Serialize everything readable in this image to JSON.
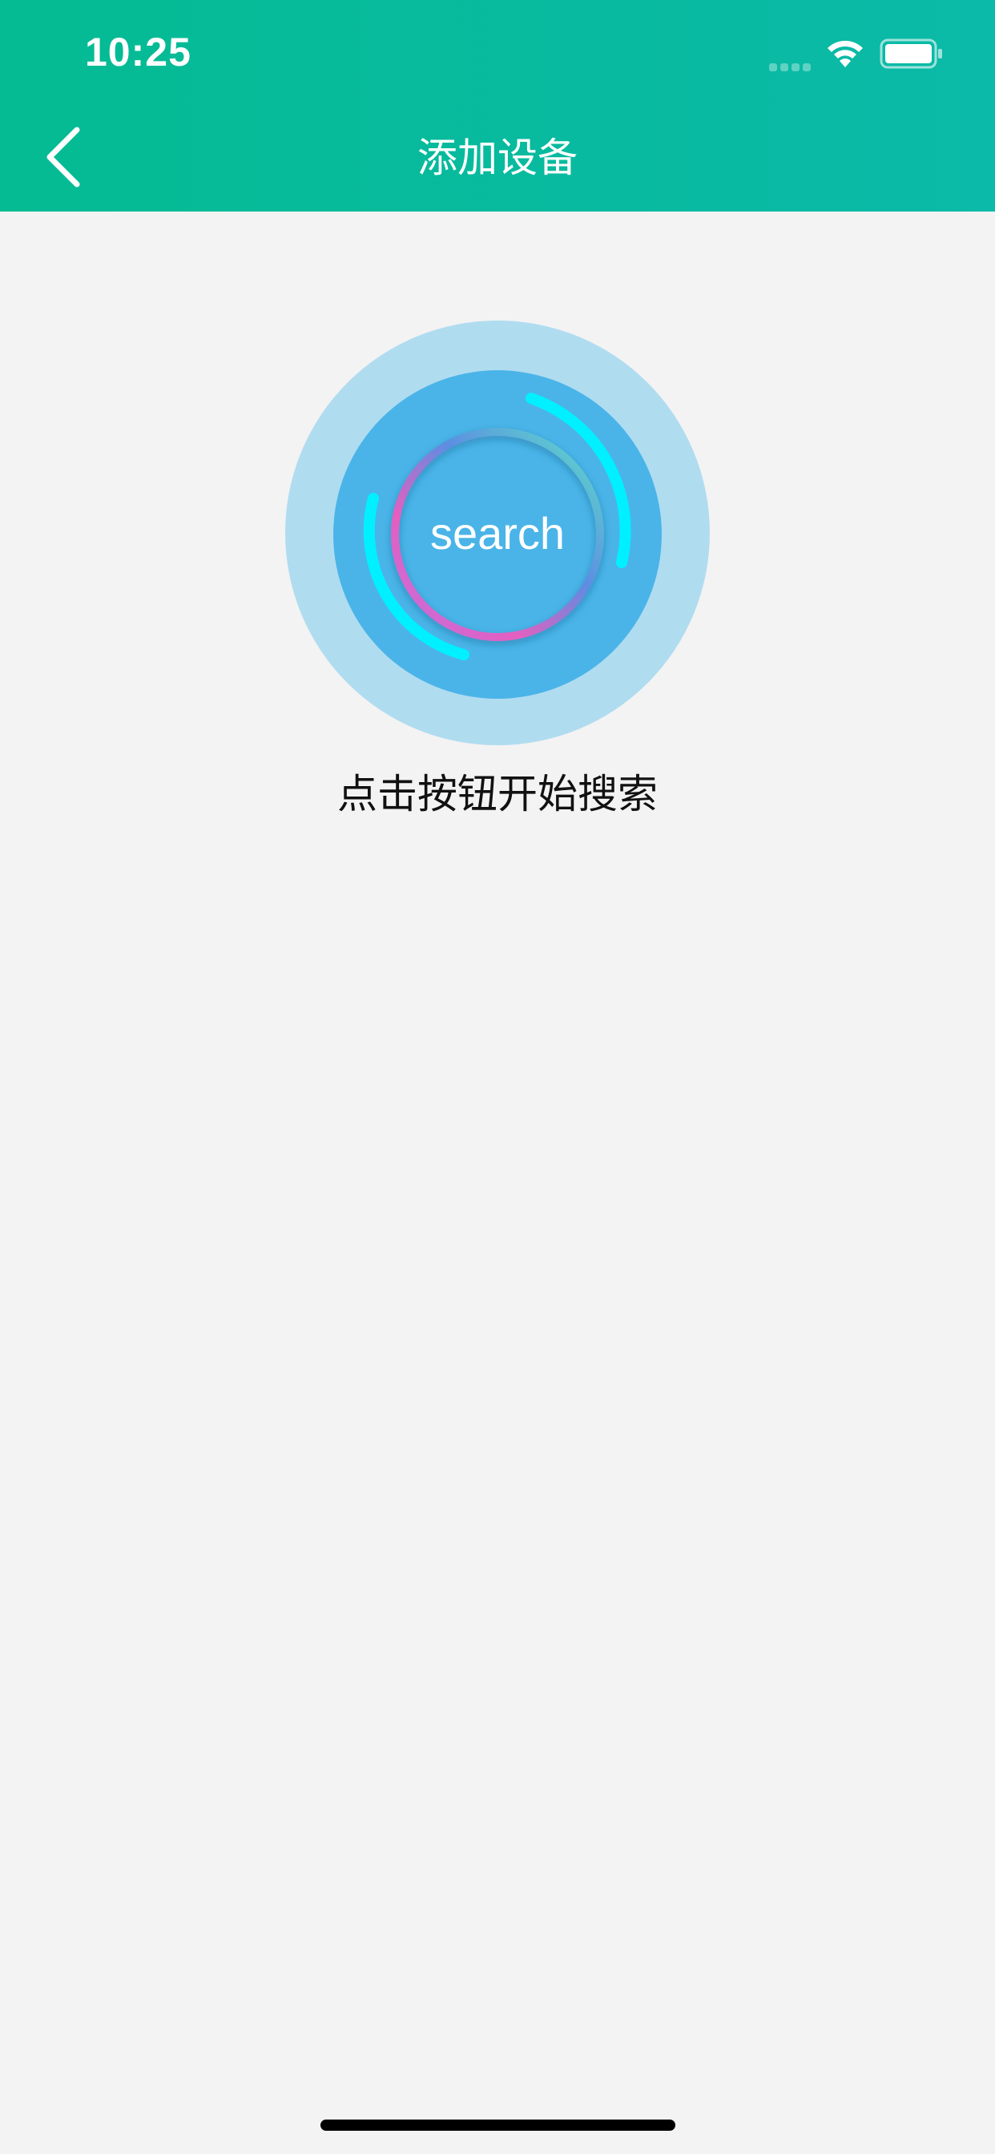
{
  "status_bar": {
    "time": "10:25"
  },
  "nav": {
    "title": "添加设备",
    "back_icon": "chevron-left-icon"
  },
  "search": {
    "label": "search",
    "icon": "radar-search-icon"
  },
  "hint": "点击按钮开始搜索",
  "colors": {
    "header_start": "#04bb93",
    "header_end": "#0bbaa8",
    "outer_circle": "#b0dcf0",
    "inner_circle": "#4ab4e8",
    "arc_cyan": "#00f0ff",
    "background": "#f3f3f3"
  }
}
